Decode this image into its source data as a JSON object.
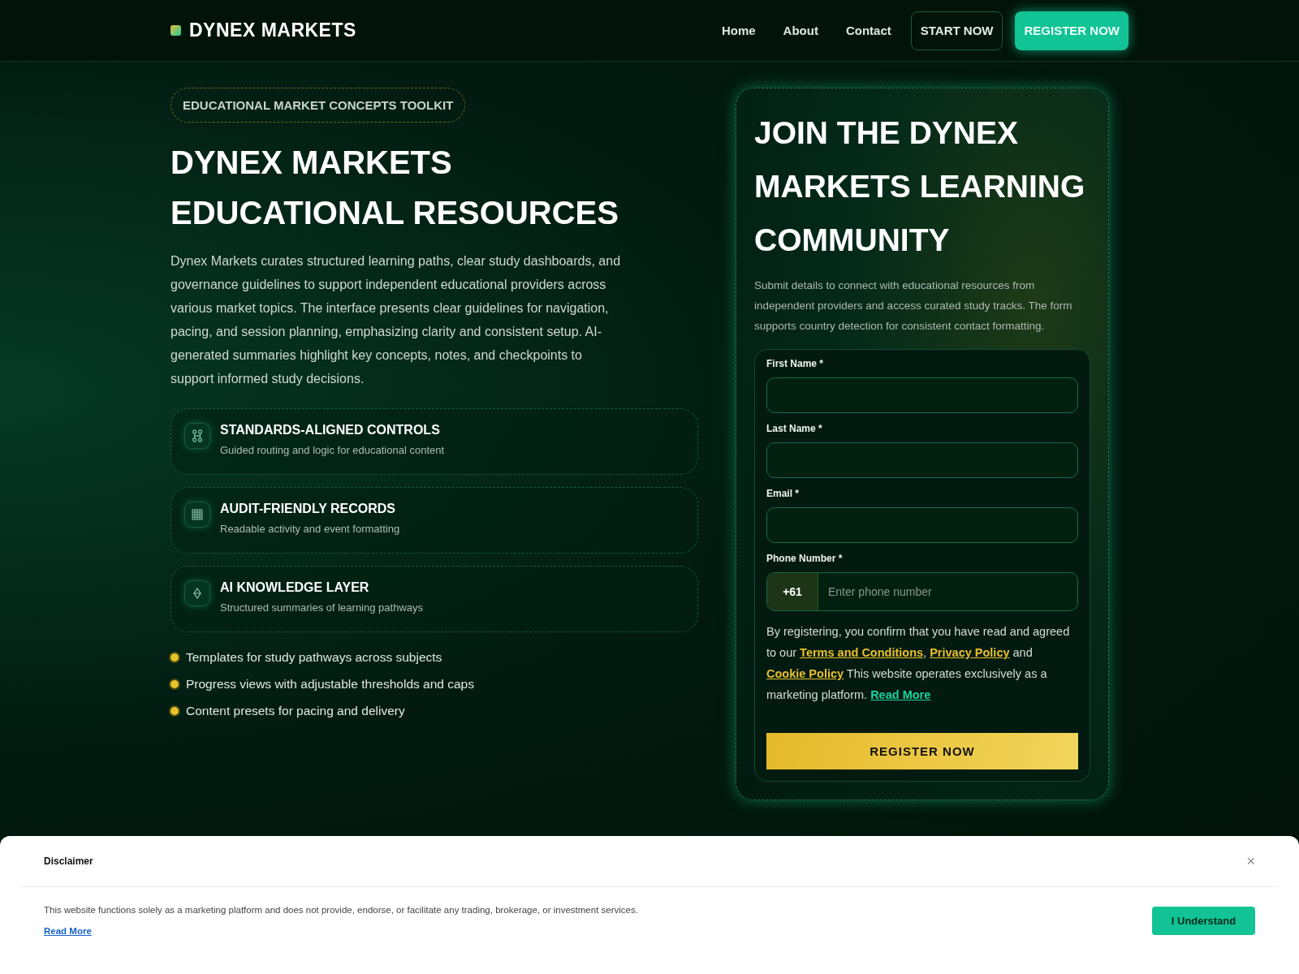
{
  "header": {
    "brand": "DYNEX MARKETS",
    "nav": [
      "Home",
      "About",
      "Contact"
    ],
    "start_button": "START NOW",
    "register_button": "REGISTER NOW"
  },
  "hero": {
    "badge": "EDUCATIONAL MARKET CONCEPTS TOOLKIT",
    "title_lines": [
      "DYNEX MARKETS",
      "EDUCATIONAL RESOURCES"
    ],
    "description": "Dynex Markets curates structured learning paths, clear study dashboards, and governance guidelines to support independent educational providers across various market topics. The interface presents clear guidelines for navigation, pacing, and session planning, emphasizing clarity and consistent setup. AI-generated summaries highlight key concepts, notes, and checkpoints to support informed study decisions.",
    "features": [
      {
        "kind": "links",
        "title": "STANDARDS-ALIGNED CONTROLS",
        "subtitle": "Guided routing and logic for educational content"
      },
      {
        "kind": "grid",
        "title": "AUDIT-FRIENDLY RECORDS",
        "subtitle": "Readable activity and event formatting"
      },
      {
        "kind": "diamond",
        "title": "AI KNOWLEDGE LAYER",
        "subtitle": "Structured summaries of learning pathways"
      }
    ],
    "bullets": [
      "Templates for study pathways across subjects",
      "Progress views with adjustable thresholds and caps",
      "Content presets for pacing and delivery"
    ]
  },
  "form_card": {
    "title": "JOIN THE DYNEX MARKETS LEARNING COMMUNITY",
    "intro": "Submit details to connect with educational resources from independent providers and access curated study tracks. The form supports country detection for consistent contact formatting.",
    "fields": [
      {
        "label": "First Name *"
      },
      {
        "label": "Last Name *"
      },
      {
        "label": "Email *"
      }
    ],
    "phone": {
      "label": "Phone Number *",
      "code": "+61",
      "placeholder": "Enter phone number"
    },
    "consent": {
      "before": "By registering, you confirm that you have read and agreed to our",
      "links": [
        "Terms and Conditions",
        "Privacy Policy",
        "Cookie Policy"
      ],
      "separator": ",",
      "joiner": "and",
      "note": "This website operates exclusively as a marketing platform.",
      "read_more": "Read More"
    },
    "submit": "REGISTER NOW"
  },
  "disclaimer": {
    "title": "Disclaimer",
    "close": "×",
    "text": "This website functions solely as a marketing platform and does not provide, endorse, or facilitate any trading, brokerage, or investment services.",
    "read_more": "Read More",
    "accept": "I Understand"
  }
}
